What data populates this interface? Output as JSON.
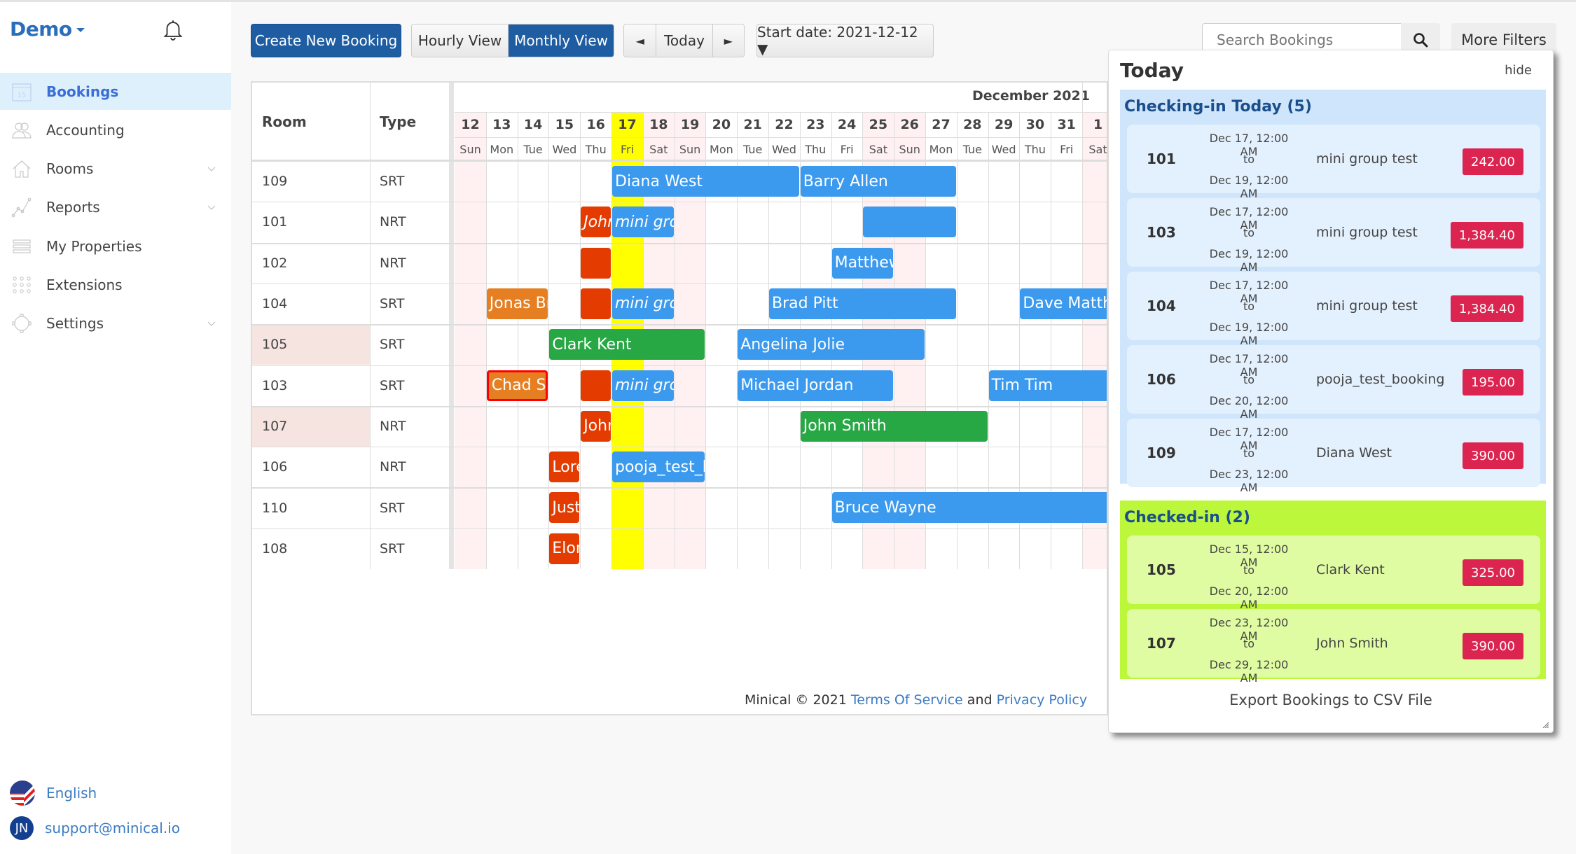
{
  "sidebar": {
    "brand": "Demo",
    "items": [
      {
        "label": "Bookings",
        "icon": "calendar-icon",
        "active": true,
        "expandable": false
      },
      {
        "label": "Accounting",
        "icon": "users-icon",
        "active": false,
        "expandable": false
      },
      {
        "label": "Rooms",
        "icon": "home-icon",
        "active": false,
        "expandable": true
      },
      {
        "label": "Reports",
        "icon": "chart-line-icon",
        "active": false,
        "expandable": true
      },
      {
        "label": "My Properties",
        "icon": "list-icon",
        "active": false,
        "expandable": false
      },
      {
        "label": "Extensions",
        "icon": "grid-dots-icon",
        "active": false,
        "expandable": false
      },
      {
        "label": "Settings",
        "icon": "gear-icon",
        "active": false,
        "expandable": true
      }
    ],
    "language": "English",
    "user_initials": "JN",
    "user_email": "support@minical.io"
  },
  "toolbar": {
    "create_label": "Create New Booking",
    "hourly_label": "Hourly View",
    "monthly_label": "Monthly View",
    "active_view": "Monthly View",
    "prev_label": "◄",
    "today_label": "Today",
    "next_label": "►",
    "start_date_label": "Start date: 2021-12-12 ▼",
    "search_placeholder": "Search Bookings",
    "more_filters_label": "More Filters"
  },
  "calendar": {
    "room_header": "Room",
    "type_header": "Type",
    "month_label": "December 2021",
    "today_index": 5,
    "days": [
      {
        "num": "12",
        "name": "Sun",
        "weekend": true
      },
      {
        "num": "13",
        "name": "Mon",
        "weekend": false
      },
      {
        "num": "14",
        "name": "Tue",
        "weekend": false
      },
      {
        "num": "15",
        "name": "Wed",
        "weekend": false
      },
      {
        "num": "16",
        "name": "Thu",
        "weekend": false
      },
      {
        "num": "17",
        "name": "Fri",
        "weekend": false
      },
      {
        "num": "18",
        "name": "Sat",
        "weekend": true
      },
      {
        "num": "19",
        "name": "Sun",
        "weekend": true
      },
      {
        "num": "20",
        "name": "Mon",
        "weekend": false
      },
      {
        "num": "21",
        "name": "Tue",
        "weekend": false
      },
      {
        "num": "22",
        "name": "Wed",
        "weekend": false
      },
      {
        "num": "23",
        "name": "Thu",
        "weekend": false
      },
      {
        "num": "24",
        "name": "Fri",
        "weekend": false
      },
      {
        "num": "25",
        "name": "Sat",
        "weekend": true
      },
      {
        "num": "26",
        "name": "Sun",
        "weekend": true
      },
      {
        "num": "27",
        "name": "Mon",
        "weekend": false
      },
      {
        "num": "28",
        "name": "Tue",
        "weekend": false
      },
      {
        "num": "29",
        "name": "Wed",
        "weekend": false
      },
      {
        "num": "30",
        "name": "Thu",
        "weekend": false
      },
      {
        "num": "31",
        "name": "Fri",
        "weekend": false
      },
      {
        "num": "1",
        "name": "Sat",
        "weekend": true
      }
    ],
    "rooms": [
      {
        "room": "109",
        "type": "SRT",
        "highlight": false
      },
      {
        "room": "101",
        "type": "NRT",
        "highlight": false
      },
      {
        "room": "102",
        "type": "NRT",
        "highlight": false
      },
      {
        "room": "104",
        "type": "SRT",
        "highlight": false
      },
      {
        "room": "105",
        "type": "SRT",
        "highlight": true
      },
      {
        "room": "103",
        "type": "SRT",
        "highlight": false
      },
      {
        "room": "107",
        "type": "NRT",
        "highlight": true
      },
      {
        "room": "106",
        "type": "NRT",
        "highlight": false
      },
      {
        "room": "110",
        "type": "SRT",
        "highlight": false
      },
      {
        "room": "108",
        "type": "SRT",
        "highlight": false
      }
    ],
    "bookings": [
      {
        "row": 0,
        "start": 5,
        "span": 6,
        "label": "Diana West",
        "color": "#3c9aee"
      },
      {
        "row": 0,
        "start": 11,
        "span": 5,
        "label": "Barry Allen",
        "color": "#3c9aee"
      },
      {
        "row": 1,
        "start": 4,
        "span": 1,
        "label": "John",
        "color": "#e33b00",
        "italic": true
      },
      {
        "row": 1,
        "start": 5,
        "span": 2,
        "label": "mini group test",
        "color": "#3c9aee",
        "italic": true
      },
      {
        "row": 1,
        "start": 13,
        "span": 3,
        "label": "",
        "color": "#3c9aee"
      },
      {
        "row": 2,
        "start": 4,
        "span": 1,
        "label": "",
        "color": "#e33b00"
      },
      {
        "row": 2,
        "start": 12,
        "span": 2,
        "label": "Matthew",
        "color": "#3c9aee"
      },
      {
        "row": 3,
        "start": 1,
        "span": 2,
        "label": "Jonas Brothers",
        "color": "#e67e22"
      },
      {
        "row": 3,
        "start": 4,
        "span": 1,
        "label": "",
        "color": "#e33b00"
      },
      {
        "row": 3,
        "start": 5,
        "span": 2,
        "label": "mini group test",
        "color": "#3c9aee",
        "italic": true
      },
      {
        "row": 3,
        "start": 10,
        "span": 6,
        "label": "Brad Pitt",
        "color": "#3c9aee"
      },
      {
        "row": 3,
        "start": 18,
        "span": 4,
        "label": "Dave Matthews",
        "color": "#3c9aee"
      },
      {
        "row": 4,
        "start": 3,
        "span": 5,
        "label": "Clark Kent",
        "color": "#27a844"
      },
      {
        "row": 4,
        "start": 9,
        "span": 6,
        "label": "Angelina Jolie",
        "color": "#3c9aee"
      },
      {
        "row": 5,
        "start": 1,
        "span": 2,
        "label": "Chad Smith",
        "color": "#e67e22",
        "border": "#ff0000"
      },
      {
        "row": 5,
        "start": 4,
        "span": 1,
        "label": "",
        "color": "#e33b00"
      },
      {
        "row": 5,
        "start": 5,
        "span": 2,
        "label": "mini group test",
        "color": "#3c9aee",
        "italic": true
      },
      {
        "row": 5,
        "start": 9,
        "span": 5,
        "label": "Michael Jordan",
        "color": "#3c9aee"
      },
      {
        "row": 5,
        "start": 17,
        "span": 5,
        "label": "Tim Tim",
        "color": "#3c9aee"
      },
      {
        "row": 6,
        "start": 4,
        "span": 1,
        "label": "John",
        "color": "#e33b00"
      },
      {
        "row": 6,
        "start": 11,
        "span": 6,
        "label": "John Smith",
        "color": "#27a844"
      },
      {
        "row": 7,
        "start": 3,
        "span": 1,
        "label": "Lorem",
        "color": "#e33b00"
      },
      {
        "row": 7,
        "start": 5,
        "span": 3,
        "label": "pooja_test_booking",
        "color": "#3c9aee"
      },
      {
        "row": 8,
        "start": 3,
        "span": 1,
        "label": "Justin",
        "color": "#e33b00"
      },
      {
        "row": 8,
        "start": 12,
        "span": 10,
        "label": "Bruce Wayne",
        "color": "#3c9aee"
      },
      {
        "row": 9,
        "start": 3,
        "span": 1,
        "label": "Elon",
        "color": "#e33b00"
      }
    ]
  },
  "footer": {
    "copyright": "Minical © 2021",
    "terms": "Terms Of Service",
    "and": "and",
    "privacy": "Privacy Policy"
  },
  "today_panel": {
    "title": "Today",
    "hide_label": "hide",
    "checking_in": {
      "title": "Checking-in Today (5)",
      "items": [
        {
          "room": "101",
          "from": "Dec 17, 12:00 AM",
          "to_label": "to",
          "to": "Dec 19, 12:00 AM",
          "guest": "mini group test",
          "amount": "242.00"
        },
        {
          "room": "103",
          "from": "Dec 17, 12:00 AM",
          "to_label": "to",
          "to": "Dec 19, 12:00 AM",
          "guest": "mini group test",
          "amount": "1,384.40"
        },
        {
          "room": "104",
          "from": "Dec 17, 12:00 AM",
          "to_label": "to",
          "to": "Dec 19, 12:00 AM",
          "guest": "mini group test",
          "amount": "1,384.40"
        },
        {
          "room": "106",
          "from": "Dec 17, 12:00 AM",
          "to_label": "to",
          "to": "Dec 20, 12:00 AM",
          "guest": "pooja_test_booking",
          "amount": "195.00"
        },
        {
          "room": "109",
          "from": "Dec 17, 12:00 AM",
          "to_label": "to",
          "to": "Dec 23, 12:00 AM",
          "guest": "Diana West",
          "amount": "390.00"
        }
      ]
    },
    "checked_in": {
      "title": "Checked-in (2)",
      "items": [
        {
          "room": "105",
          "from": "Dec 15, 12:00 AM",
          "to_label": "to",
          "to": "Dec 20, 12:00 AM",
          "guest": "Clark Kent",
          "amount": "325.00"
        },
        {
          "room": "107",
          "from": "Dec 23, 12:00 AM",
          "to_label": "to",
          "to": "Dec 29, 12:00 AM",
          "guest": "John Smith",
          "amount": "390.00"
        }
      ]
    },
    "export_label": "Export Bookings to CSV File"
  },
  "colors": {
    "primary": "#1f5da3",
    "booking_blue": "#3c9aee",
    "booking_green": "#27a844",
    "booking_red": "#e33b00",
    "booking_orange": "#e67e22",
    "today_yellow": "#ffff00",
    "checkin_bg": "#cfe5fb",
    "checkin_card": "#e3f0fd",
    "checkedin_bg": "#bdf73c",
    "checkedin_card": "#e0fca3",
    "amount_badge": "#dc2450"
  }
}
